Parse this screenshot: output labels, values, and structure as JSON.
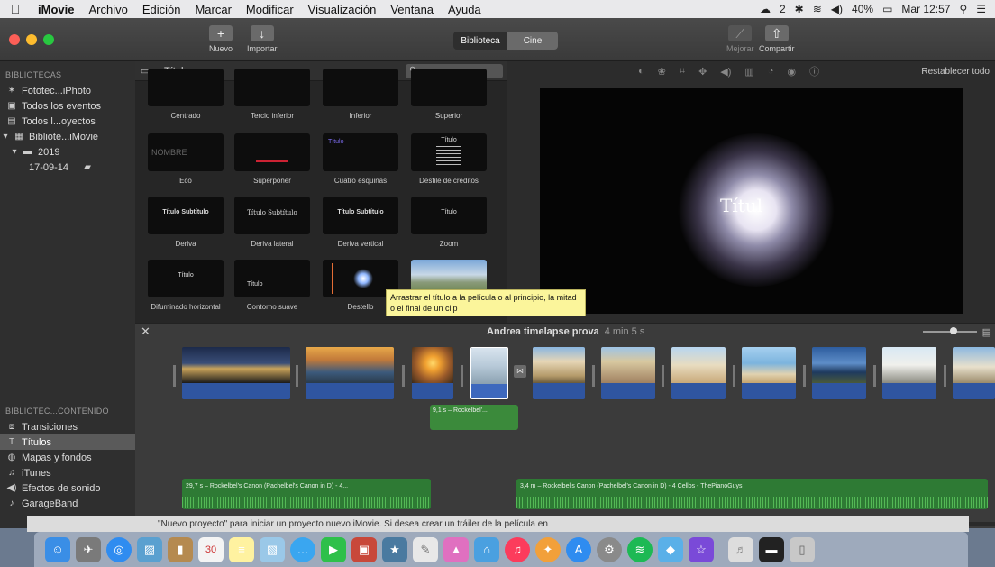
{
  "menubar": {
    "app": "iMovie",
    "items": [
      "Archivo",
      "Edición",
      "Marcar",
      "Modificar",
      "Visualización",
      "Ventana",
      "Ayuda"
    ],
    "tray_counter": "2",
    "battery": "40%",
    "clock": "Mar 12:57"
  },
  "toolbar": {
    "new_label": "Nuevo",
    "import_label": "Importar",
    "library_tab": "Biblioteca",
    "cinema_tab": "Cine",
    "improve_label": "Mejorar",
    "share_label": "Compartir"
  },
  "sidebar": {
    "libraries_header": "BIBLIOTECAS",
    "library_items": [
      {
        "label": "Fototec...iPhoto",
        "icon": "star-icon"
      },
      {
        "label": "Todos los eventos",
        "icon": "film-icon"
      },
      {
        "label": "Todos l...oyectos",
        "icon": "list-icon"
      },
      {
        "label": "Bibliote...iMovie",
        "icon": "grid-icon"
      },
      {
        "label": "2019",
        "icon": "folder-icon"
      },
      {
        "label": "17-09-14",
        "icon": "clapper-icon"
      }
    ],
    "content_header": "BIBLIOTEC...CONTENIDO",
    "content_items": [
      {
        "label": "Transiciones",
        "icon": "transition-icon"
      },
      {
        "label": "Títulos",
        "icon": "text-icon"
      },
      {
        "label": "Mapas y fondos",
        "icon": "globe-icon"
      },
      {
        "label": "iTunes",
        "icon": "music-note-icon"
      },
      {
        "label": "Efectos de sonido",
        "icon": "speaker-icon"
      },
      {
        "label": "GarageBand",
        "icon": "guitar-icon"
      }
    ]
  },
  "browser": {
    "title": "Títulos",
    "search_placeholder": "",
    "tiles": [
      {
        "label": "Centrado",
        "text": ""
      },
      {
        "label": "Tercio inferior",
        "text": ""
      },
      {
        "label": "Inferior",
        "text": ""
      },
      {
        "label": "Superior",
        "text": ""
      },
      {
        "label": "Eco",
        "text": "NOMBRE"
      },
      {
        "label": "Superponer",
        "text": ""
      },
      {
        "label": "Cuatro esquinas",
        "text": "Título"
      },
      {
        "label": "Desfile de créditos",
        "text": "Título"
      },
      {
        "label": "Deriva",
        "text": "Título Subtítulo"
      },
      {
        "label": "Deriva lateral",
        "text": "Título Subtítulo"
      },
      {
        "label": "Deriva vertical",
        "text": "Título Subtítulo"
      },
      {
        "label": "Zoom",
        "text": "Título"
      },
      {
        "label": "Difuminado horizontal",
        "text": "Título"
      },
      {
        "label": "Contorno suave",
        "text": "Título"
      },
      {
        "label": "Destello",
        "text": ""
      },
      {
        "label": "",
        "text": ""
      }
    ],
    "tooltip": "Arrastrar el título a la película o al principio, la mitad o el final de un clip"
  },
  "viewer": {
    "reset_label": "Restablecer todo",
    "title_text": "Títul"
  },
  "timeline": {
    "project_name": "Andrea timelapse prova",
    "duration": "4 min 5 s",
    "title_clip": "9,1 s – Rockelbel'...",
    "music_1": "29,7 s – Rockelbel's Canon (Pachelbel's Canon in D) - 4...",
    "music_2": "3,4 m – Rockelbel's Canon (Pachelbel's Canon in D) - 4 Cellos - ThePianoGuys"
  },
  "notice": "\"Nuevo proyecto\" para iniciar un proyecto nuevo iMovie. Si desea crear un tráiler de la película en",
  "colors": {
    "window_bg": "#2b2b2b",
    "audio_blue": "#2f55a0",
    "music_green": "#2e7a34",
    "tooltip_yellow": "#fbf59b"
  }
}
